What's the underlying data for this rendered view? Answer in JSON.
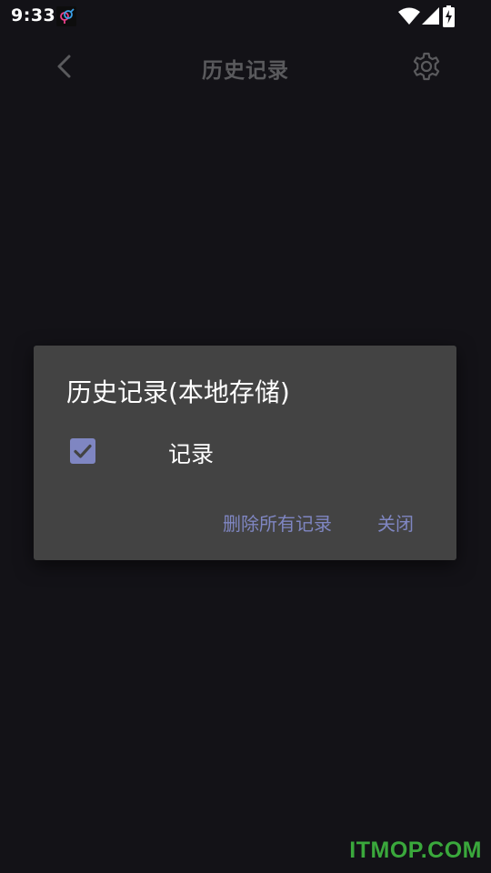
{
  "status_bar": {
    "time": "9:33",
    "icons": [
      "app-notification-icon",
      "wifi-icon",
      "cell-signal-icon",
      "battery-charging-icon"
    ]
  },
  "header": {
    "title": "历史记录",
    "back_icon": "chevron-left-icon",
    "settings_icon": "gear-icon"
  },
  "dialog": {
    "title": "历史记录(本地存储)",
    "checkbox": {
      "label": "记录",
      "checked": true
    },
    "actions": {
      "delete_all": "删除所有记录",
      "close": "关闭"
    }
  },
  "watermark": "ITMOP.COM",
  "colors": {
    "background": "#131217",
    "dialog_bg": "#434343",
    "accent": "#7f86c2",
    "header_dim": "#5a5a5d",
    "watermark": "#3aa83c"
  }
}
